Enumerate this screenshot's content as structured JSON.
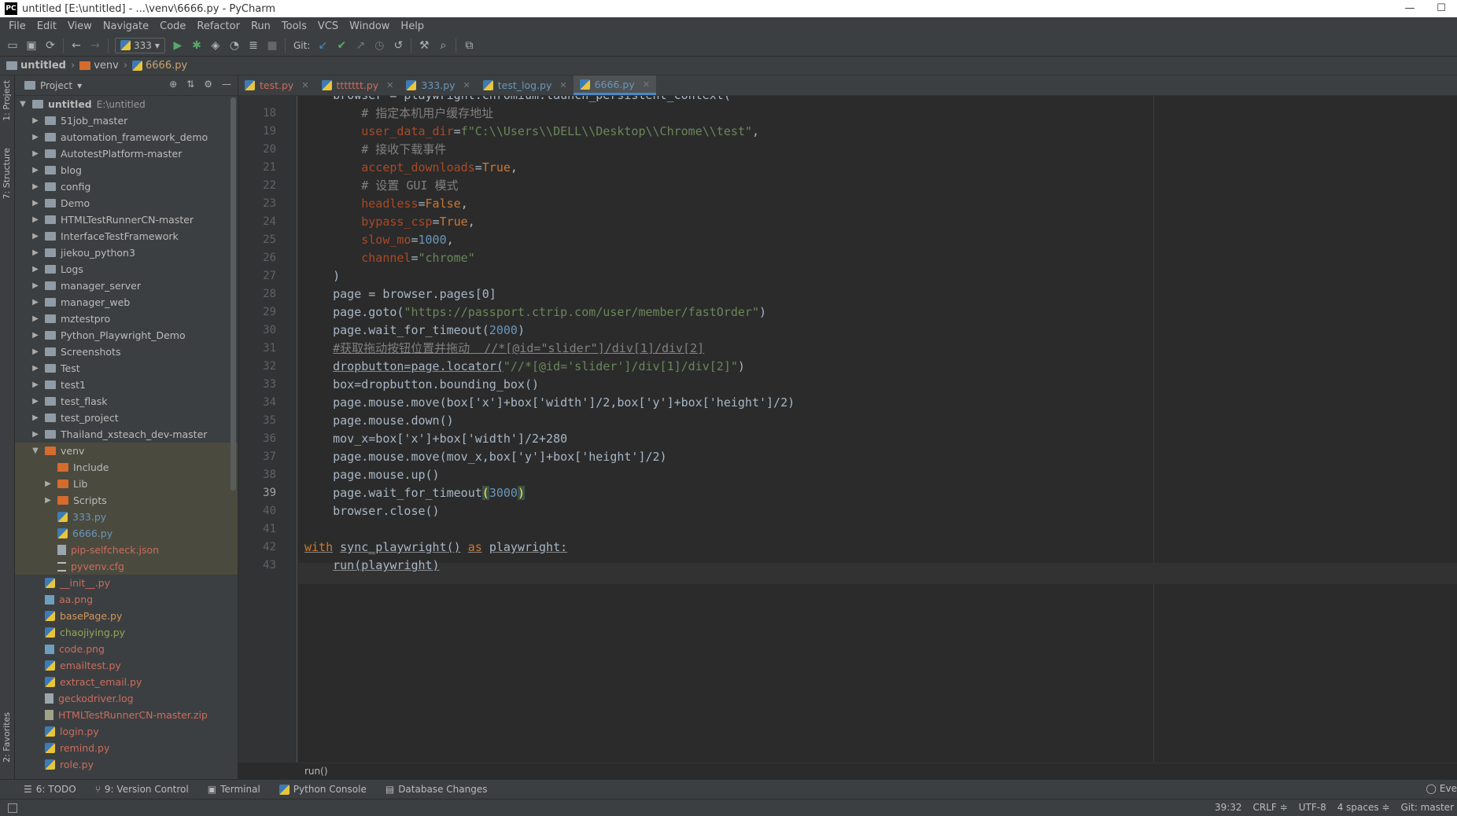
{
  "window": {
    "title": "untitled [E:\\untitled] - ...\\venv\\6666.py - PyCharm",
    "logo_text": "PC",
    "controls": [
      "—",
      "☐"
    ]
  },
  "menu": [
    "File",
    "Edit",
    "View",
    "Navigate",
    "Code",
    "Refactor",
    "Run",
    "Tools",
    "VCS",
    "Window",
    "Help"
  ],
  "toolbar": {
    "run_config": "333",
    "git_label": "Git:"
  },
  "breadcrumb": {
    "project": "untitled",
    "folder": "venv",
    "file": "6666.py"
  },
  "left_strip": {
    "project_tab": "1: Project",
    "structure_tab": "7: Structure",
    "favorites_tab": "2: Favorites"
  },
  "project_panel": {
    "title": "Project",
    "root_name": "untitled",
    "root_path": "E:\\untitled",
    "folders": [
      "51job_master",
      "automation_framework_demo",
      "AutotestPlatform-master",
      "blog",
      "config",
      "Demo",
      "HTMLTestRunnerCN-master",
      "InterfaceTestFramework",
      "jiekou_python3",
      "Logs",
      "manager_server",
      "manager_web",
      "mztestpro",
      "Python_Playwright_Demo",
      "Screenshots",
      "Test",
      "test1",
      "test_flask",
      "test_project",
      "Thailand_xsteach_dev-master"
    ],
    "venv": {
      "name": "venv",
      "children": {
        "include": "Include",
        "lib": "Lib",
        "scripts": "Scripts",
        "file1": "333.py",
        "file2": "6666.py",
        "file3": "pip-selfcheck.json",
        "file4": "pyvenv.cfg"
      }
    },
    "files": {
      "f1": "__init__.py",
      "f2": "aa.png",
      "f3": "basePage.py",
      "f4": "chaojiying.py",
      "f5": "code.png",
      "f6": "emailtest.py",
      "f7": "extract_email.py",
      "f8": "geckodriver.log",
      "f9": "HTMLTestRunnerCN-master.zip",
      "f10": "login.py",
      "f11": "remind.py",
      "f12": "role.py"
    }
  },
  "editor_tabs": [
    "test.py",
    "ttttttt.py",
    "333.py",
    "test_log.py",
    "6666.py"
  ],
  "active_tab": "6666.py",
  "code": {
    "first_line_partial": "    browser = playwright.chromium.launch_persistent_context(",
    "line_numbers": [
      "18",
      "19",
      "20",
      "21",
      "22",
      "23",
      "24",
      "25",
      "26",
      "27",
      "28",
      "29",
      "30",
      "31",
      "32",
      "33",
      "34",
      "35",
      "36",
      "37",
      "38",
      "39",
      "40",
      "41",
      "42",
      "43"
    ],
    "current_line": "39",
    "l18_comment": "# 指定本机用户缓存地址",
    "l19_key": "user_data_dir",
    "l19_val": "f\"C:\\\\Users\\\\DELL\\\\Desktop\\\\Chrome\\\\test\"",
    "l20_comment": "# 接收下载事件",
    "l21_key": "accept_downloads",
    "l21_val": "True",
    "l22_comment": "# 设置 GUI 模式",
    "l23_key": "headless",
    "l23_val": "False",
    "l24_key": "bypass_csp",
    "l24_val": "True",
    "l25_key": "slow_mo",
    "l25_val": "1000",
    "l26_key": "channel",
    "l26_val": "\"chrome\"",
    "l27": ")",
    "l28": "page = browser.pages[0]",
    "l29_pre": "page.goto(",
    "l29_url": "\"https://passport.ctrip.com/user/member/fastOrder\"",
    "l30_pre": "page.wait_for_timeout(",
    "l30_num": "2000",
    "l31": "#获取拖动按钮位置并拖动  //*[@id=\"slider\"]/div[1]/div[2]",
    "l32_pre": "dropbutton=page.locator(",
    "l32_str": "\"//*[@id='slider']/div[1]/div[2]\"",
    "l33": "box=dropbutton.bounding_box()",
    "l34": "page.mouse.move(box['x']+box['width']/2,box['y']+box['height']/2)",
    "l35": "page.mouse.down()",
    "l36": "mov_x=box['x']+box['width']/2+280",
    "l37": "page.mouse.move(mov_x,box['y']+box['height']/2)",
    "l38": "page.mouse.up()",
    "l39_pre": "page.wait_for_timeout",
    "l39_num": "3000",
    "l40": "browser.close()",
    "l42_kw1": "with",
    "l42_mid": "sync_playwright()",
    "l42_kw2": "as",
    "l42_end": "playwright:",
    "l43": "run(playwright)"
  },
  "code_breadcrumb": "run()",
  "bottom_tools": [
    "6: TODO",
    "9: Version Control",
    "Terminal",
    "Python Console",
    "Database Changes"
  ],
  "event_log": "Eve",
  "status": {
    "position": "39:32",
    "line_sep": "CRLF ≑",
    "encoding": "UTF-8",
    "indent": "4 spaces ≑",
    "vcs": "Git: master"
  },
  "colors": {
    "editor_bg": "#2b2b2b",
    "panel_bg": "#3c3f41",
    "keyword": "#cc7832",
    "string": "#6a8759",
    "number": "#6897bb",
    "comment": "#808080",
    "kwarg": "#aa4926",
    "active_tab_underline": "#4a88c7"
  }
}
